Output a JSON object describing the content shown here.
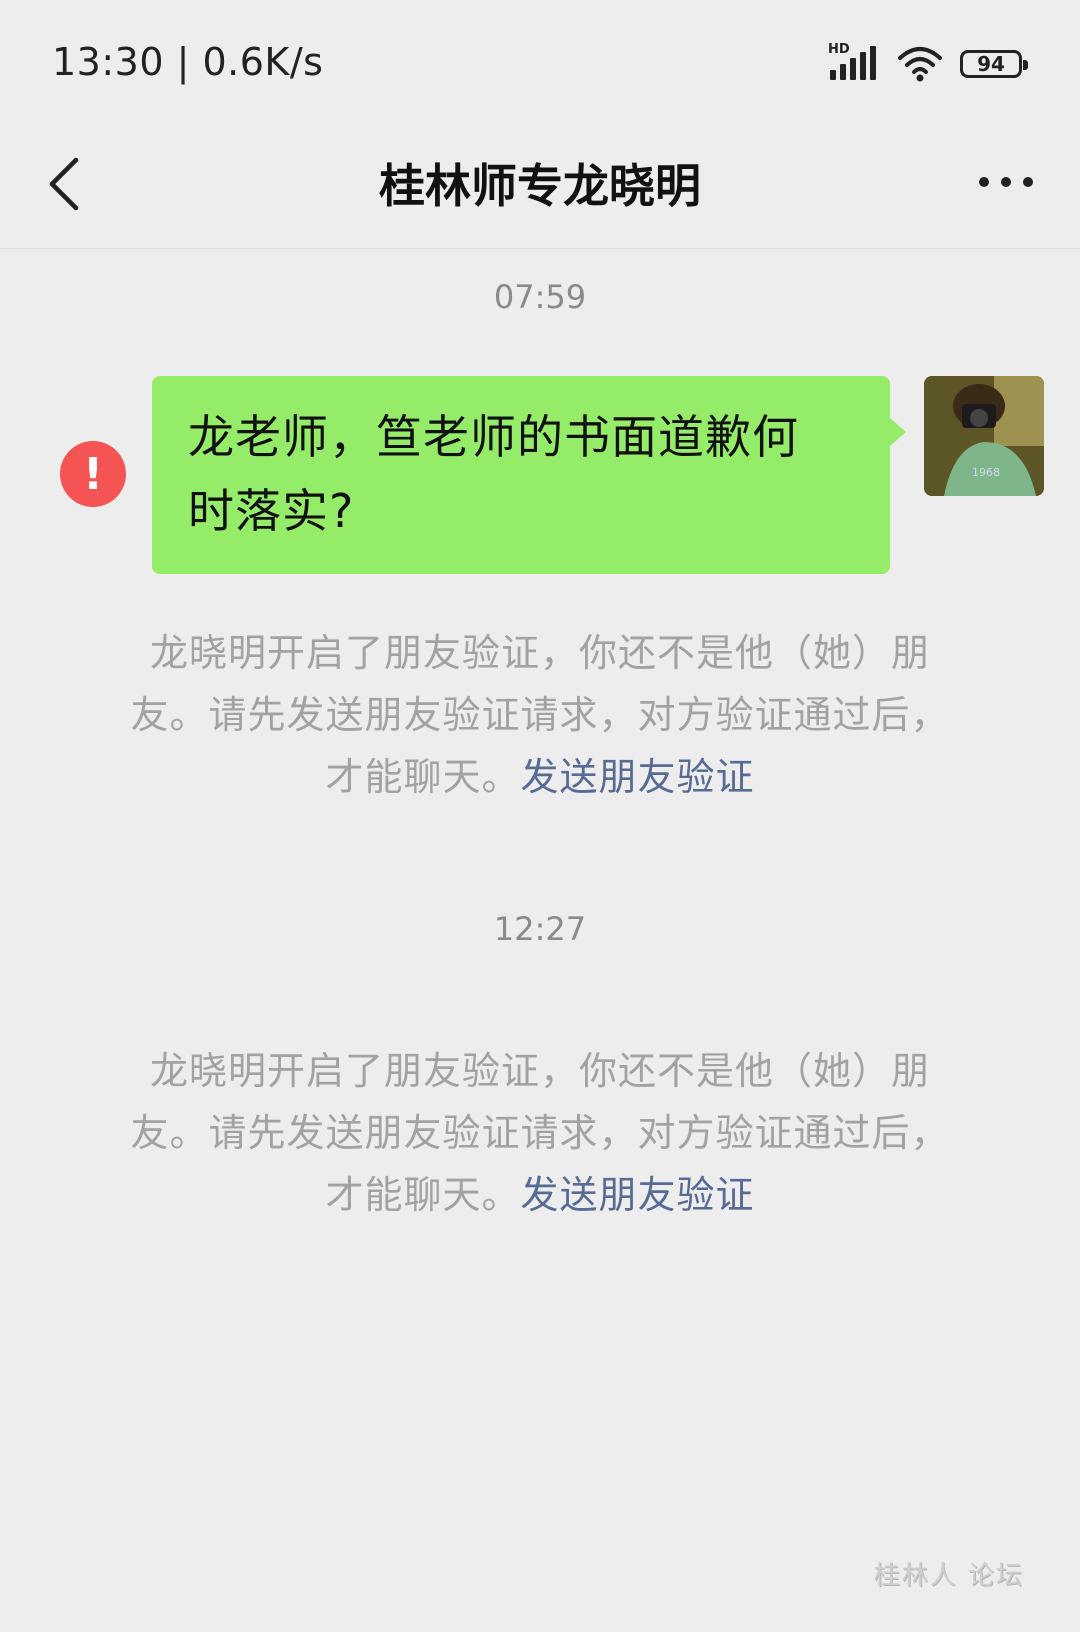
{
  "status_bar": {
    "time_speed": "13:30 | 0.6K/s",
    "network_label": "HD",
    "battery_level": "94"
  },
  "header": {
    "title": "桂林师专龙晓明"
  },
  "conversation": {
    "timestamp_1": "07:59",
    "sent_message_line1": "龙老师，笪老师的书面道歉何",
    "sent_message_line2": "时落实?",
    "error_icon_glyph": "!",
    "notice_1": {
      "line1": "龙晓明开启了朋友验证，你还不是他（她）朋",
      "line2": "友。请先发送朋友验证请求，对方验证通过后，",
      "line3_text": "才能聊天。",
      "link": "发送朋友验证"
    },
    "timestamp_2": "12:27",
    "notice_2": {
      "line1": "龙晓明开启了朋友验证，你还不是他（她）朋",
      "line2": "友。请先发送朋友验证请求，对方验证通过后，",
      "line3_text": "才能聊天。",
      "link": "发送朋友验证"
    }
  },
  "watermark": "桂林人 论坛",
  "colors": {
    "background": "#ededed",
    "bubble": "#95ec69",
    "link": "#576b95",
    "error": "#f45454"
  }
}
